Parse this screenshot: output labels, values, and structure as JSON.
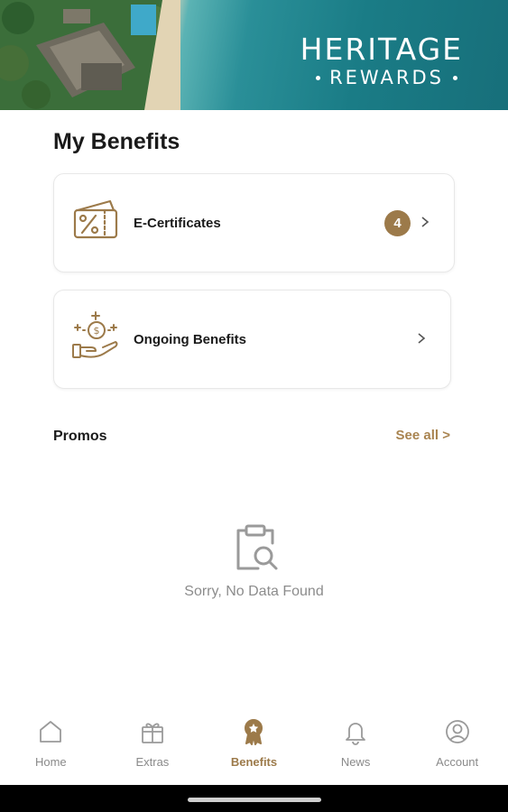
{
  "brand": {
    "title": "HERITAGE",
    "subtitle": "REWARDS"
  },
  "page": {
    "title": "My Benefits"
  },
  "benefits": [
    {
      "label": "E-Certificates",
      "badge": "4",
      "icon": "percent-ticket-icon"
    },
    {
      "label": "Ongoing Benefits",
      "icon": "coin-hand-icon"
    }
  ],
  "promos": {
    "title": "Promos",
    "see_all": "See all >",
    "empty_text": "Sorry, No Data Found",
    "empty_icon": "clipboard-search-icon"
  },
  "nav": {
    "items": [
      {
        "label": "Home",
        "icon": "home-icon"
      },
      {
        "label": "Extras",
        "icon": "gift-icon"
      },
      {
        "label": "Benefits",
        "icon": "award-badge-icon",
        "active": true
      },
      {
        "label": "News",
        "icon": "bell-icon"
      },
      {
        "label": "Account",
        "icon": "user-circle-icon"
      }
    ]
  },
  "colors": {
    "accent": "#9c7a4a",
    "muted": "#8a8a8a",
    "sea": "#1a7c86"
  }
}
